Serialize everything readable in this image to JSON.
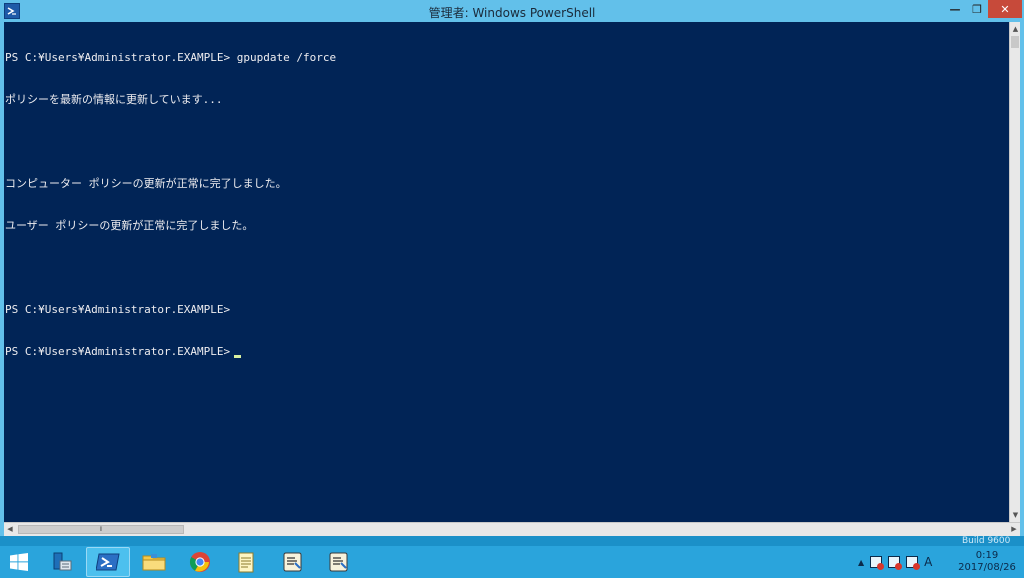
{
  "window": {
    "title": "管理者: Windows PowerShell",
    "controls": {
      "minimize": "—",
      "maximize": "❐",
      "close": "✕"
    }
  },
  "console": {
    "lines": [
      "PS C:¥Users¥Administrator.EXAMPLE> gpupdate /force",
      "ポリシーを最新の情報に更新しています...",
      "",
      "コンピューター ポリシーの更新が正常に完了しました。",
      "ユーザー ポリシーの更新が正常に完了しました。",
      "",
      "PS C:¥Users¥Administrator.EXAMPLE>",
      "PS C:¥Users¥Administrator.EXAMPLE>"
    ]
  },
  "desktop": {
    "build_text": "Build 9600"
  },
  "taskbar": {
    "apps": [
      {
        "name": "server-manager-icon"
      },
      {
        "name": "powershell-icon"
      },
      {
        "name": "file-explorer-icon"
      },
      {
        "name": "chrome-icon"
      },
      {
        "name": "notepad-icon"
      },
      {
        "name": "script-icon"
      },
      {
        "name": "script-icon"
      }
    ],
    "ime": "A",
    "clock": {
      "time": "0:19",
      "date": "2017/08/26"
    }
  },
  "colors": {
    "console_bg": "#012456",
    "console_text": "#eeedf0",
    "titlebar": "#62c0ea",
    "taskbar": "#2aa4dc",
    "close_button": "#c74a3a"
  }
}
